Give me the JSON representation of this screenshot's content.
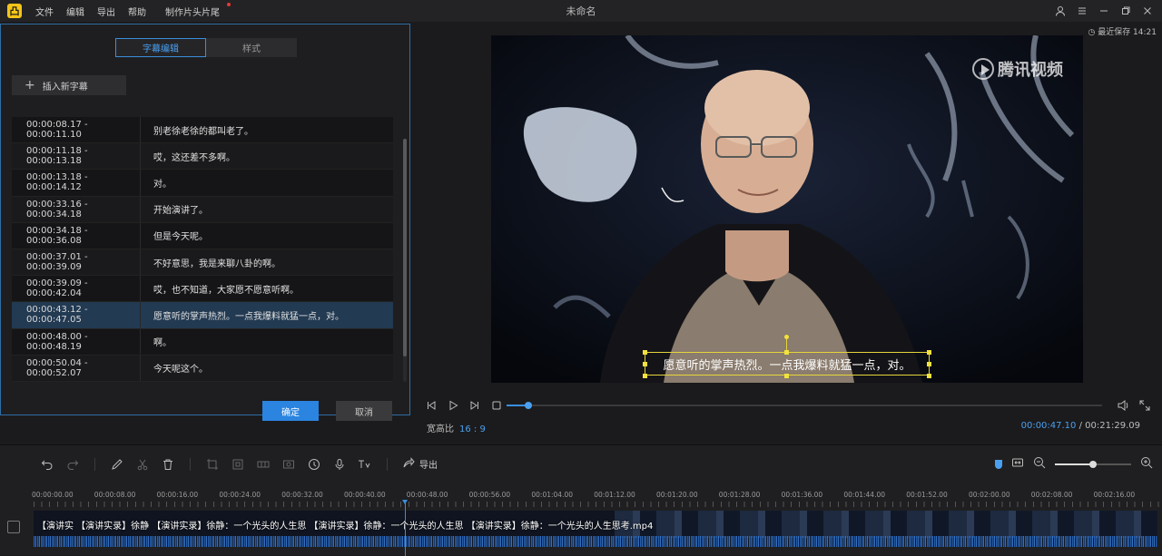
{
  "app": {
    "title": "未命名",
    "logo_glyph": "凸",
    "menu": [
      "文件",
      "编辑",
      "导出",
      "帮助",
      "制作片头片尾"
    ],
    "window_icons": [
      "user-icon",
      "menu-icon",
      "minimize-icon",
      "maximize-icon",
      "close-icon"
    ]
  },
  "editor": {
    "tabs": [
      "字幕编辑",
      "样式"
    ],
    "insert_label": "插入新字幕",
    "subtitles": [
      {
        "time": "00:00:08.17 - 00:00:11.10",
        "text": "别老徐老徐的都叫老了。"
      },
      {
        "time": "00:00:11.18 - 00:00:13.18",
        "text": "哎，这还差不多啊。"
      },
      {
        "time": "00:00:13.18 - 00:00:14.12",
        "text": "对。"
      },
      {
        "time": "00:00:33.16 - 00:00:34.18",
        "text": "开始演讲了。"
      },
      {
        "time": "00:00:34.18 - 00:00:36.08",
        "text": "但是今天呢。"
      },
      {
        "time": "00:00:37.01 - 00:00:39.09",
        "text": "不好意思，我是来聊八卦的啊。"
      },
      {
        "time": "00:00:39.09 - 00:00:42.04",
        "text": "哎，也不知道，大家愿不愿意听啊。"
      },
      {
        "time": "00:00:43.12 - 00:00:47.05",
        "text": "愿意听的掌声热烈。一点我爆料就猛一点，对。"
      },
      {
        "time": "00:00:48.00 - 00:00:48.19",
        "text": "啊。"
      },
      {
        "time": "00:00:50.04 - 00:00:52.07",
        "text": "今天呢这个。"
      }
    ],
    "selected_index": 7,
    "confirm_label": "确定",
    "cancel_label": "取消"
  },
  "preview": {
    "saved_label": "最近保存 14:21",
    "watermark": "腾讯视频",
    "subtitle_text": "愿意听的掌声热烈。一点我爆料就猛一点，对。",
    "progress_fraction": 0.037,
    "ratio_label": "宽高比",
    "ratio_value": "16 : 9",
    "current_time": "00:00:47.10",
    "separator": "/",
    "total_time": "00:21:29.09"
  },
  "timeline": {
    "export_label": "导出",
    "ruler_labels": [
      "00:00:00.00",
      "00:00:08.00",
      "00:00:16.00",
      "00:00:24.00",
      "00:00:32.00",
      "00:00:40.00",
      "00:00:48.00",
      "00:00:56.00",
      "00:01:04.00",
      "00:01:12.00",
      "00:01:20.00",
      "00:01:28.00",
      "00:01:36.00",
      "00:01:44.00",
      "00:01:52.00",
      "00:02:00.00",
      "00:02:08.00",
      "00:02:16.00"
    ],
    "track_text": "【演讲实  【演讲实录】徐静    【演讲实录】徐静：一个光头的人生思  【演讲实录】徐静：一个光头的人生思  【演讲实录】徐静：一个光头的人生思考.mp4",
    "zoom_fraction": 0.5,
    "accent_color": "#3a8ede"
  }
}
